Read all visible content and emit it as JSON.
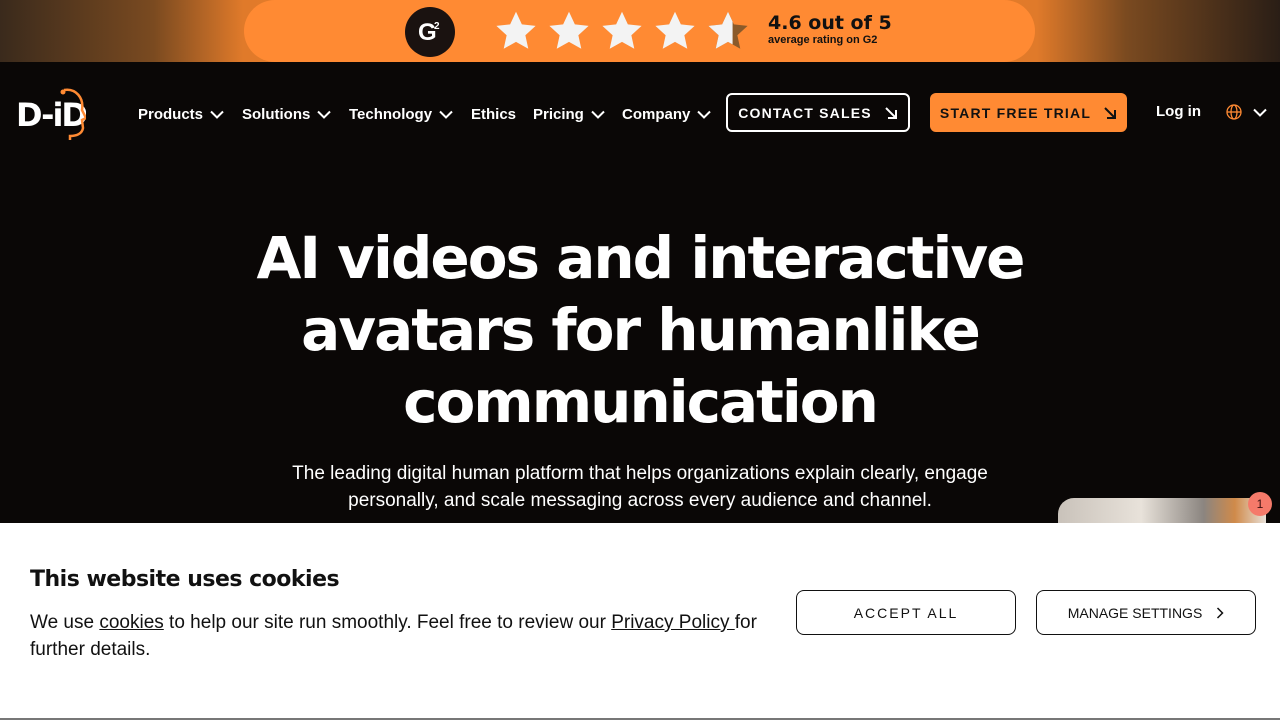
{
  "banner": {
    "g2_label": "G2",
    "rating_main": "4.6 out of 5",
    "rating_sub": "average rating on G2",
    "rating_value": 4.6,
    "rating_max": 5,
    "colors": {
      "accent": "#ff8a33",
      "star": "#f3f3f3",
      "star_empty": "#8a5a2a"
    }
  },
  "nav": {
    "logo_text": "D-iD",
    "items": [
      {
        "label": "Products",
        "has_dropdown": true
      },
      {
        "label": "Solutions",
        "has_dropdown": true
      },
      {
        "label": "Technology",
        "has_dropdown": true
      },
      {
        "label": "Ethics",
        "has_dropdown": false
      },
      {
        "label": "Pricing",
        "has_dropdown": true
      },
      {
        "label": "Company",
        "has_dropdown": true
      }
    ],
    "contact_label": "CONTACT SALES",
    "trial_label": "START FREE TRIAL",
    "login_label": "Log in",
    "globe_icon": "globe-icon"
  },
  "hero": {
    "title_line1": "AI videos and interactive",
    "title_line2": "avatars for humanlike",
    "title_line3": "communication",
    "subtitle_line1": "The leading digital human platform that helps organizations explain clearly, engage",
    "subtitle_line2": "personally, and scale messaging across every audience and channel."
  },
  "widget": {
    "badge_count": "1"
  },
  "cookie": {
    "title": "This website uses cookies",
    "text_pre": "We use ",
    "cookies_link": "cookies",
    "text_mid": " to help our site run smoothly. Feel free to review our ",
    "privacy_link": "Privacy Policy ",
    "text_post": "for further details.",
    "accept_label": "ACCEPT ALL",
    "manage_label": "MANAGE SETTINGS"
  }
}
